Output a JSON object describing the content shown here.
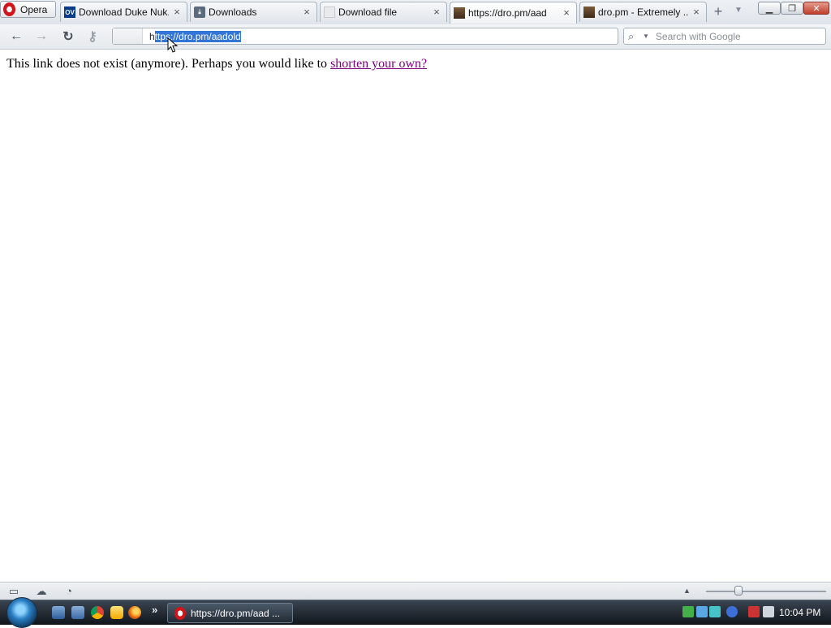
{
  "browser": {
    "menu_label": "Opera",
    "tabs": [
      {
        "label": "Download Duke Nuk...",
        "favicon": "ov-icon",
        "favicon_text": "OV"
      },
      {
        "label": "Downloads",
        "favicon": "download-icon"
      },
      {
        "label": "Download file",
        "favicon": "file-icon"
      },
      {
        "label": "https://dro.pm/aad",
        "favicon": "dro-icon",
        "active": true
      },
      {
        "label": "dro.pm - Extremely ...",
        "favicon": "dro-icon"
      }
    ]
  },
  "address": {
    "prefix": "h",
    "selected": "ttps://dro.pm/aadold"
  },
  "search": {
    "placeholder": "Search with Google"
  },
  "content": {
    "message": "This link does not exist (anymore). Perhaps you would like to",
    "link_text": "shorten your own?"
  },
  "taskbar": {
    "task_label": "https://dro.pm/aad ...",
    "clock": "10:04 PM"
  },
  "colors": {
    "link_visited": "#800080",
    "selection": "#3375d6",
    "close_button": "#c0402e"
  }
}
